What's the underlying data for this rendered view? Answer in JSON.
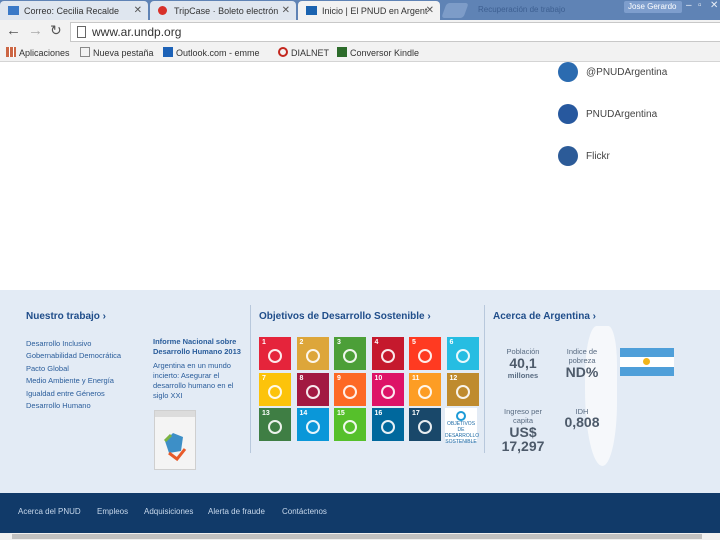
{
  "browser": {
    "tabs": [
      {
        "title": "Correo: Cecilia Recalde",
        "active": false
      },
      {
        "title": "TripCase · Boleto electrón",
        "active": false
      },
      {
        "title": "Inicio | El PNUD en Argent",
        "active": true
      }
    ],
    "ghost_tab": "Recuperación de trabajo",
    "user": "Jose Gerardo",
    "url": "www.ar.undp.org",
    "bookmarks": [
      "Aplicaciones",
      "Nueva pestaña",
      "Outlook.com - emme",
      "DIALNET",
      "Conversor Kindle"
    ]
  },
  "social": [
    {
      "label": "@PNUDArgentina",
      "icon": "twitter-icon"
    },
    {
      "label": "PNUDArgentina",
      "icon": "facebook-icon"
    },
    {
      "label": "Flickr",
      "icon": "flickr-icon"
    }
  ],
  "work": {
    "title": "Nuestro trabajo ›",
    "links": [
      "Desarrollo Inclusivo",
      "Gobernabilidad Democrática",
      "Pacto Global",
      "Medio Ambiente y Energía",
      "Igualdad entre Géneros",
      "Desarrollo Humano"
    ],
    "report_title": "Informe Nacional sobre Desarrollo Humano 2013",
    "report_text": "Argentina en un mundo incierto: Asegurar el desarrollo humano en el siglo XXI"
  },
  "sdg": {
    "title": "Objetivos de Desarrollo Sostenible ›",
    "goals": [
      {
        "n": "1",
        "color": "#e5243b"
      },
      {
        "n": "2",
        "color": "#dda63a"
      },
      {
        "n": "3",
        "color": "#4c9f38"
      },
      {
        "n": "4",
        "color": "#c5192d"
      },
      {
        "n": "5",
        "color": "#ff3a21"
      },
      {
        "n": "6",
        "color": "#26bde2"
      },
      {
        "n": "7",
        "color": "#fcc30b"
      },
      {
        "n": "8",
        "color": "#a21942"
      },
      {
        "n": "9",
        "color": "#fd6925"
      },
      {
        "n": "10",
        "color": "#dd1367"
      },
      {
        "n": "11",
        "color": "#fd9d24"
      },
      {
        "n": "12",
        "color": "#bf8b2e"
      },
      {
        "n": "13",
        "color": "#3f7e44"
      },
      {
        "n": "14",
        "color": "#0a97d9"
      },
      {
        "n": "15",
        "color": "#56c02b"
      },
      {
        "n": "16",
        "color": "#00689d"
      },
      {
        "n": "17",
        "color": "#19486a"
      }
    ],
    "logo_text": "OBJETIVOS DE DESARROLLO SOSTENIBLE"
  },
  "argentina": {
    "title": "Acerca de Argentina ›",
    "population_label": "Población",
    "population_value": "40,1",
    "population_unit": "millones",
    "poverty_label": "Indice de pobreza",
    "poverty_value": "ND%",
    "income_label": "Ingreso per capita",
    "income_currency": "US$",
    "income_value": "17,297",
    "idh_label": "IDH",
    "idh_value": "0,808"
  },
  "bottom_links": [
    "Acerca del PNUD",
    "Empleos",
    "Adquisiciones",
    "Alerta de fraude",
    "Contáctenos"
  ]
}
